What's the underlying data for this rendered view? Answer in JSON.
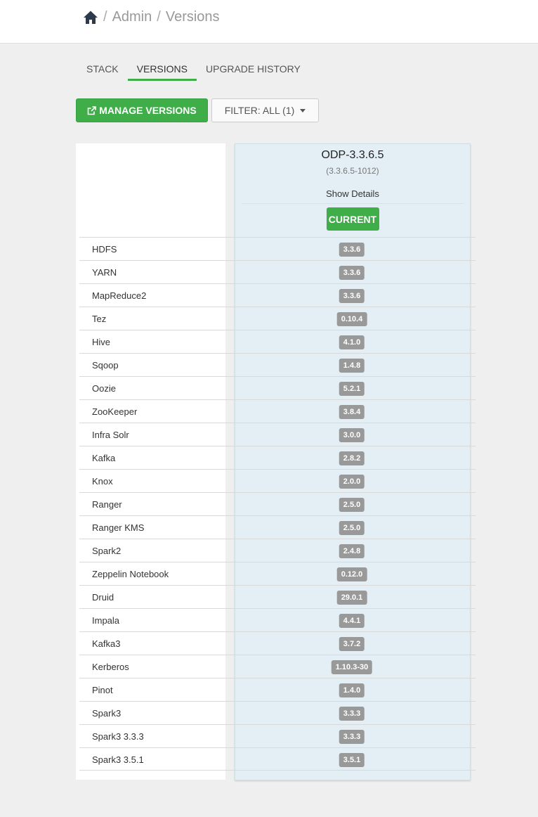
{
  "breadcrumb": {
    "home_icon": "home-icon",
    "separator": "/",
    "items": [
      "Admin",
      "Versions"
    ]
  },
  "tabs": [
    {
      "label": "STACK",
      "active": false
    },
    {
      "label": "VERSIONS",
      "active": true
    },
    {
      "label": "UPGRADE HISTORY",
      "active": false
    }
  ],
  "toolbar": {
    "manage_icon": "external-link-icon",
    "manage_label": "MANAGE VERSIONS",
    "filter_label": "FILTER: ALL (1)"
  },
  "version": {
    "name": "ODP-3.3.6.5",
    "build": "(3.3.6.5-1012)",
    "show_details": "Show Details",
    "status_label": "CURRENT"
  },
  "colors": {
    "accent": "#3fae49",
    "version_column": "#e3eff4",
    "badge": "#999999"
  },
  "services": [
    {
      "name": "HDFS",
      "version": "3.3.6"
    },
    {
      "name": "YARN",
      "version": "3.3.6"
    },
    {
      "name": "MapReduce2",
      "version": "3.3.6"
    },
    {
      "name": "Tez",
      "version": "0.10.4"
    },
    {
      "name": "Hive",
      "version": "4.1.0"
    },
    {
      "name": "Sqoop",
      "version": "1.4.8"
    },
    {
      "name": "Oozie",
      "version": "5.2.1"
    },
    {
      "name": "ZooKeeper",
      "version": "3.8.4"
    },
    {
      "name": "Infra Solr",
      "version": "3.0.0"
    },
    {
      "name": "Kafka",
      "version": "2.8.2"
    },
    {
      "name": "Knox",
      "version": "2.0.0"
    },
    {
      "name": "Ranger",
      "version": "2.5.0"
    },
    {
      "name": "Ranger KMS",
      "version": "2.5.0"
    },
    {
      "name": "Spark2",
      "version": "2.4.8"
    },
    {
      "name": "Zeppelin Notebook",
      "version": "0.12.0"
    },
    {
      "name": "Druid",
      "version": "29.0.1"
    },
    {
      "name": "Impala",
      "version": "4.4.1"
    },
    {
      "name": "Kafka3",
      "version": "3.7.2"
    },
    {
      "name": "Kerberos",
      "version": "1.10.3-30"
    },
    {
      "name": "Pinot",
      "version": "1.4.0"
    },
    {
      "name": "Spark3",
      "version": "3.3.3"
    },
    {
      "name": "Spark3 3.3.3",
      "version": "3.3.3"
    },
    {
      "name": "Spark3 3.5.1",
      "version": "3.5.1"
    }
  ]
}
